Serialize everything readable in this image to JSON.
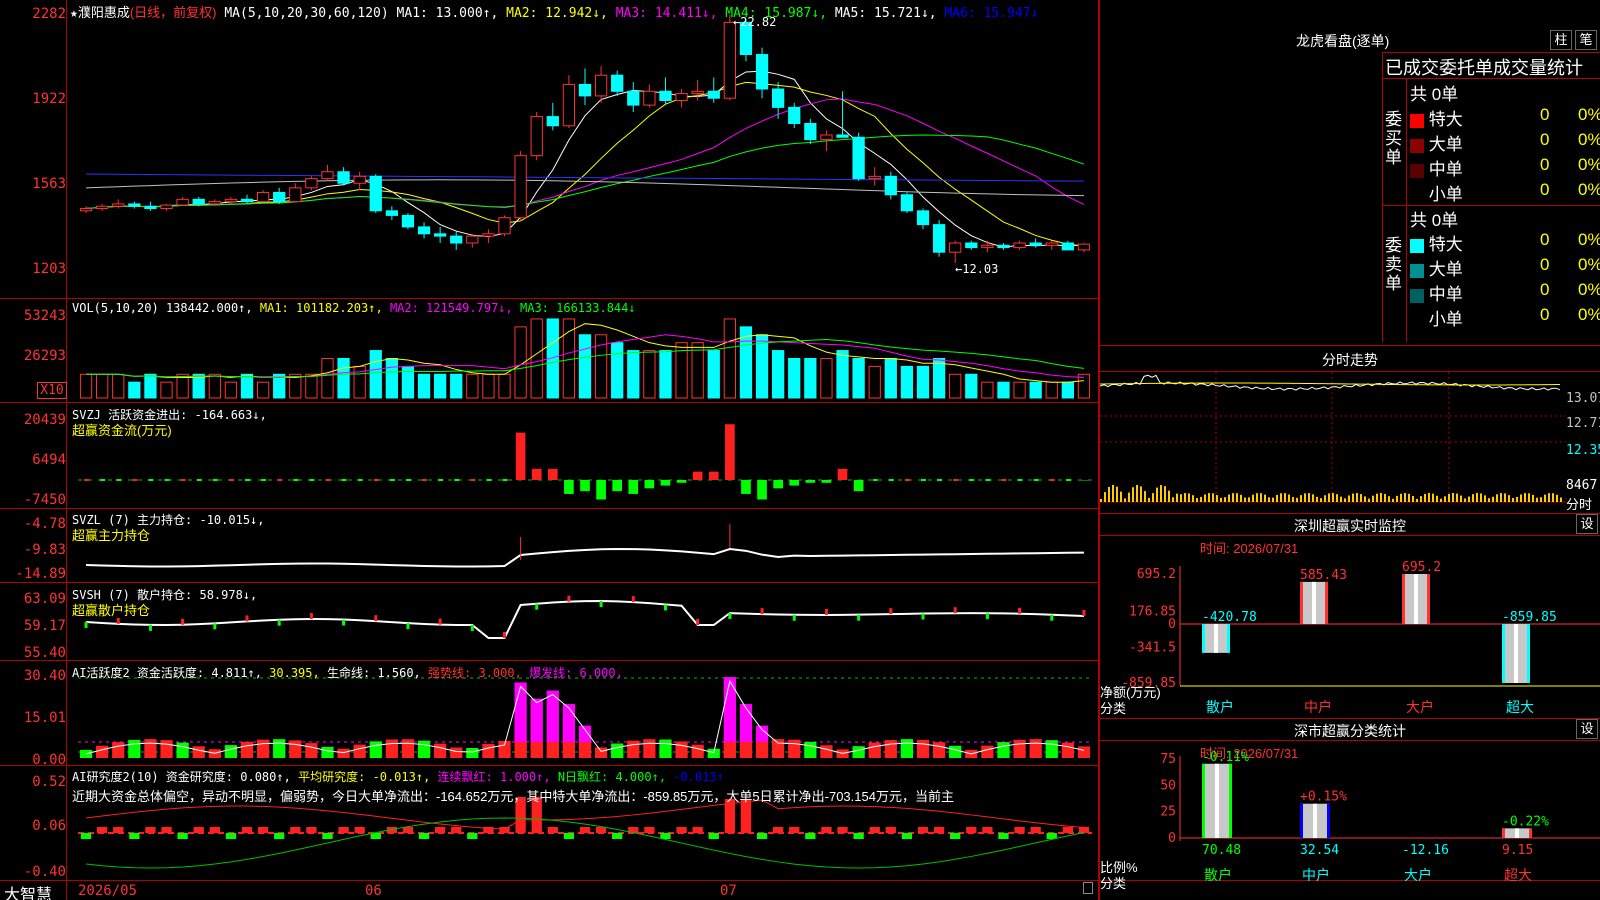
{
  "header": {
    "star": "★",
    "stock_name": "濮阳惠成",
    "period": "(日线，前复权)",
    "ma_label": "MA(5,10,20,30,60,120)",
    "ma1": "MA1: 13.000↑,",
    "ma2": "MA2: 12.942↓,",
    "ma3": "MA3: 14.411↓,",
    "ma4": "MA4: 15.987↓,",
    "ma5": "MA5: 15.721↓,",
    "ma6": "MA6: 15.947↓"
  },
  "price_axis": [
    "22.82",
    "19.22",
    "15.63",
    "12.03"
  ],
  "price_axis_labels": [
    "2282",
    "1922",
    "1563",
    "1203"
  ],
  "annotations": {
    "high": "22.82",
    "low": "←12.03"
  },
  "vol_panel": {
    "title": "VOL(5,10,20)",
    "vol": "138442.000↑,",
    "ma1": "MA1: 101182.203↑,",
    "ma2": "MA2: 121549.797↓,",
    "ma3": "MA3: 166133.844↓",
    "axis": [
      "53243",
      "26293"
    ],
    "unit": "X10"
  },
  "svzj_panel": {
    "title": "SVZJ  活跃资金进出: -164.663↓,",
    "subtitle": "超赢资金流(万元)",
    "axis": [
      "20439",
      "6494",
      "-7450"
    ]
  },
  "svzl_panel": {
    "title": "SVZL (7) 主力持仓: -10.015↓,",
    "subtitle": "超赢主力持仓",
    "axis": [
      "-4.78",
      "-9.83",
      "-14.89"
    ]
  },
  "svsh_panel": {
    "title": "SVSH (7) 散户持仓: 58.978↓,",
    "subtitle": "超赢散户持仓",
    "axis": [
      "63.09",
      "59.17",
      "55.40"
    ]
  },
  "ai1_panel": {
    "t1": "AI活跃度2 资金活跃度: 4.811↑,",
    "t2": "30.395,",
    "t3": "生命线: 1.560,",
    "t4": "强势线: 3.000,",
    "t5": "爆发线: 6.000,",
    "axis": [
      "30.40",
      "15.01",
      "0.00"
    ]
  },
  "ai2_panel": {
    "t1": "AI研究度2(10) 资金研究度: 0.080↑,",
    "t2": "平均研究度: -0.013↑,",
    "t3": "连续飘红: 1.000↑,",
    "t4": "N日飘红: 4.000↑,",
    "t5": "-0.013↑",
    "commentary": "近期大资金总体偏空，异动不明显，偏弱势，今日大单净流出：-164.652万元，其中特大单净流出：-859.85万元，大单5日累计净出-703.154万元，当前主",
    "axis": [
      "0.52",
      "0.06",
      "-0.40"
    ]
  },
  "bottom_bar": {
    "brand": "大智慧",
    "d1": "2026/05",
    "d2": "06",
    "d3": "07"
  },
  "lhb": {
    "title": "龙虎看盘(逐单)",
    "btn1": "柱",
    "btn2": "笔",
    "subtitle": "已成交委托单成交量统计",
    "buy_label": "委买单",
    "sell_label": "委卖单",
    "buy_total": "共 0单",
    "sell_total": "共 0单",
    "buy_rows": [
      {
        "name": "特大",
        "count": "0",
        "pct": "0%",
        "color": "#ff0000"
      },
      {
        "name": "大单",
        "count": "0",
        "pct": "0%",
        "color": "#8b0000"
      },
      {
        "name": "中单",
        "count": "0",
        "pct": "0%",
        "color": "#5a0000"
      },
      {
        "name": "小单",
        "count": "0",
        "pct": "0%",
        "color": "#000000"
      }
    ],
    "sell_rows": [
      {
        "name": "特大",
        "count": "0",
        "pct": "0%",
        "color": "#00ffff"
      },
      {
        "name": "大单",
        "count": "0",
        "pct": "0%",
        "color": "#009090"
      },
      {
        "name": "中单",
        "count": "0",
        "pct": "0%",
        "color": "#006060"
      },
      {
        "name": "小单",
        "count": "0",
        "pct": "0%",
        "color": "#000000"
      }
    ]
  },
  "intraday": {
    "title": "分时走势",
    "axis": [
      "13.07",
      "12.71",
      "12.35",
      "8467"
    ],
    "unit": "分时"
  },
  "sz_monitor": {
    "title": "深圳超赢实时监控",
    "btn": "设",
    "time": "时间: 2026/07/31",
    "axis": [
      "695.2",
      "176.85",
      "0",
      "-341.5",
      "-859.85"
    ],
    "ylabel1": "净额(万元)",
    "ylabel2": "分类",
    "categories": [
      "散户",
      "中户",
      "大户",
      "超大"
    ],
    "values": [
      -420.78,
      585.43,
      695.2,
      -859.85
    ],
    "value_labels": [
      "-420.78",
      "585.43",
      "695.2",
      "-859.85"
    ]
  },
  "sz_class": {
    "title": "深市超赢分类统计",
    "btn": "设",
    "time": "时间: 2026/07/31",
    "axis": [
      "75",
      "50",
      "25",
      "0"
    ],
    "ylabel1": "比例%",
    "ylabel2": "分类",
    "categories": [
      "散户",
      "中户",
      "大户",
      "超大"
    ],
    "values": [
      70.48,
      32.54,
      -12.16,
      9.15
    ],
    "value_labels": [
      "70.48",
      "32.54",
      "-12.16",
      "9.15"
    ],
    "changes": [
      "-0.11%",
      "+0.15%",
      "",
      "-0.22%"
    ]
  },
  "chart_data": [
    {
      "type": "candlestick",
      "x": [
        "2026/05",
        "06",
        "07"
      ],
      "ylim": [
        12.03,
        22.82
      ],
      "series": [
        {
          "name": "MA1",
          "values": [
            13.0
          ]
        },
        {
          "name": "MA2",
          "values": [
            12.942
          ]
        },
        {
          "name": "MA3",
          "values": [
            14.411
          ]
        },
        {
          "name": "MA4",
          "values": [
            15.987
          ]
        },
        {
          "name": "MA5",
          "values": [
            15.721
          ]
        },
        {
          "name": "MA6",
          "values": [
            15.947
          ]
        }
      ],
      "candles_ohlc": [
        [
          14.3,
          14.5,
          14.2,
          14.4
        ],
        [
          14.4,
          14.6,
          14.3,
          14.5
        ],
        [
          14.5,
          14.8,
          14.4,
          14.6
        ],
        [
          14.6,
          14.7,
          14.4,
          14.5
        ],
        [
          14.5,
          14.7,
          14.3,
          14.4
        ],
        [
          14.4,
          14.6,
          14.3,
          14.55
        ],
        [
          14.55,
          14.9,
          14.5,
          14.8
        ],
        [
          14.8,
          14.9,
          14.5,
          14.6
        ],
        [
          14.6,
          14.8,
          14.5,
          14.7
        ],
        [
          14.7,
          14.9,
          14.6,
          14.8
        ],
        [
          14.8,
          15.0,
          14.6,
          14.7
        ],
        [
          14.7,
          15.2,
          14.7,
          15.1
        ],
        [
          15.1,
          15.3,
          14.6,
          14.7
        ],
        [
          14.7,
          15.5,
          14.7,
          15.3
        ],
        [
          15.3,
          15.8,
          15.2,
          15.7
        ],
        [
          15.7,
          16.3,
          15.6,
          16.0
        ],
        [
          16.0,
          16.2,
          15.4,
          15.5
        ],
        [
          15.5,
          16.0,
          15.2,
          15.8
        ],
        [
          15.8,
          15.9,
          14.2,
          14.3
        ],
        [
          14.3,
          14.5,
          13.9,
          14.1
        ],
        [
          14.1,
          14.2,
          13.5,
          13.6
        ],
        [
          13.6,
          13.8,
          13.1,
          13.3
        ],
        [
          13.3,
          13.6,
          12.9,
          13.2
        ],
        [
          13.2,
          13.4,
          12.6,
          12.9
        ],
        [
          12.9,
          13.3,
          12.7,
          13.2
        ],
        [
          13.2,
          13.5,
          12.9,
          13.3
        ],
        [
          13.3,
          14.1,
          13.2,
          14.0
        ],
        [
          14.0,
          16.9,
          13.9,
          16.7
        ],
        [
          16.7,
          18.6,
          16.5,
          18.4
        ],
        [
          18.4,
          19.0,
          17.8,
          18.0
        ],
        [
          18.0,
          20.2,
          17.9,
          19.8
        ],
        [
          19.8,
          20.5,
          18.9,
          19.3
        ],
        [
          19.3,
          20.6,
          19.0,
          20.2
        ],
        [
          20.2,
          20.4,
          19.3,
          19.5
        ],
        [
          19.5,
          19.9,
          18.6,
          18.9
        ],
        [
          18.9,
          19.8,
          18.8,
          19.5
        ],
        [
          19.5,
          20.1,
          18.9,
          19.1
        ],
        [
          19.1,
          19.6,
          18.8,
          19.4
        ],
        [
          19.4,
          20.0,
          19.1,
          19.5
        ],
        [
          19.5,
          20.1,
          19.0,
          19.2
        ],
        [
          19.2,
          22.82,
          19.1,
          22.5
        ],
        [
          22.5,
          22.6,
          20.8,
          21.1
        ],
        [
          21.1,
          21.4,
          19.2,
          19.6
        ],
        [
          19.6,
          19.9,
          18.3,
          18.8
        ],
        [
          18.8,
          19.0,
          17.9,
          18.1
        ],
        [
          18.1,
          18.3,
          17.2,
          17.4
        ],
        [
          17.4,
          17.8,
          16.9,
          17.6
        ],
        [
          17.6,
          19.5,
          17.5,
          17.5
        ],
        [
          17.5,
          17.7,
          15.6,
          15.7
        ],
        [
          15.7,
          16.2,
          15.4,
          15.8
        ],
        [
          15.8,
          16.0,
          14.8,
          15.0
        ],
        [
          15.0,
          15.1,
          14.2,
          14.3
        ],
        [
          14.3,
          14.4,
          13.5,
          13.7
        ],
        [
          13.7,
          13.9,
          12.3,
          12.5
        ],
        [
          12.5,
          13.0,
          12.03,
          12.9
        ],
        [
          12.9,
          13.0,
          12.6,
          12.7
        ],
        [
          12.7,
          13.0,
          12.5,
          12.8
        ],
        [
          12.8,
          12.9,
          12.6,
          12.7
        ],
        [
          12.7,
          13.0,
          12.6,
          12.9
        ],
        [
          12.9,
          13.1,
          12.7,
          12.8
        ],
        [
          12.8,
          13.0,
          12.6,
          12.9
        ],
        [
          12.9,
          13.0,
          12.6,
          12.6
        ],
        [
          12.6,
          12.9,
          12.5,
          12.85
        ]
      ]
    },
    {
      "type": "bar",
      "title": "VOL(5,10,20)",
      "ylim": [
        0,
        53243
      ],
      "values": [
        3,
        3,
        3,
        2,
        3,
        2,
        3,
        3,
        3,
        2,
        3,
        2,
        3,
        3,
        3,
        5,
        5,
        4,
        6,
        5,
        4,
        3,
        3,
        3,
        3,
        3,
        3,
        9,
        10,
        10,
        10,
        8,
        8,
        7,
        6,
        6,
        6,
        7,
        7,
        6,
        10,
        9,
        8,
        6,
        5,
        5,
        5,
        6,
        5,
        4,
        5,
        4,
        4,
        5,
        3,
        3,
        2,
        2,
        2,
        2,
        2,
        2,
        3
      ],
      "series": [
        {
          "name": "MA1",
          "values": [
            101182.203
          ]
        },
        {
          "name": "MA2",
          "values": [
            121549.797
          ]
        },
        {
          "name": "MA3",
          "values": [
            166133.844
          ]
        }
      ]
    },
    {
      "type": "bar",
      "title": "SVZJ",
      "ylim": [
        -7450,
        20439
      ],
      "values": [
        0,
        0,
        0,
        0,
        0,
        0,
        0,
        0,
        0,
        0,
        0,
        0,
        0,
        0,
        0,
        0,
        0,
        0,
        0,
        0,
        0,
        0,
        0,
        0,
        0,
        0,
        0,
        17000,
        4000,
        4000,
        -5000,
        -4000,
        -7000,
        -4000,
        -5000,
        -3000,
        -2000,
        -1000,
        3000,
        3000,
        20000,
        -5000,
        -7000,
        -3000,
        -2000,
        -1000,
        -1000,
        4000,
        -4000,
        0,
        0,
        0,
        0,
        0,
        0,
        0,
        0,
        0,
        0,
        0,
        0,
        0,
        -164.663
      ]
    },
    {
      "type": "bar",
      "title": "SZ 净额(万元)",
      "categories": [
        "散户",
        "中户",
        "大户",
        "超大"
      ],
      "values": [
        -420.78,
        585.43,
        695.2,
        -859.85
      ],
      "ylim": [
        -859.85,
        695.2
      ]
    },
    {
      "type": "bar",
      "title": "SZ 比例%",
      "categories": [
        "散户",
        "中户",
        "大户",
        "超大"
      ],
      "values": [
        70.48,
        32.54,
        -12.16,
        9.15
      ],
      "ylim": [
        0,
        75
      ]
    }
  ]
}
